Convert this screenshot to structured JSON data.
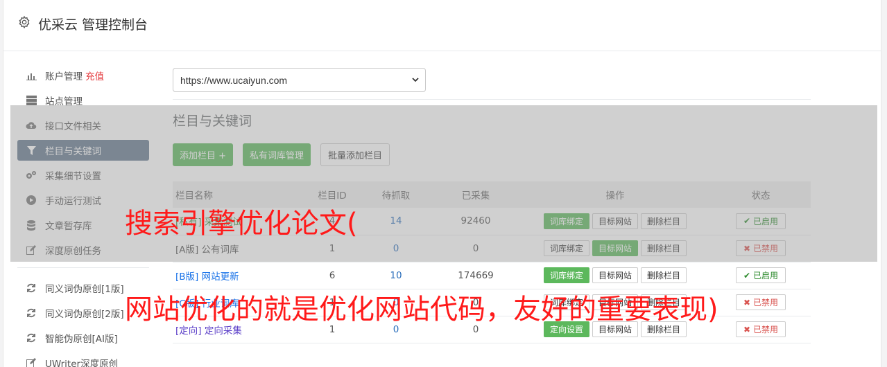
{
  "header": {
    "title": "优采云 管理控制台"
  },
  "sidebar": {
    "items": [
      {
        "label": "账户管理",
        "badge": "充值",
        "icon": "bar-chart-icon"
      },
      {
        "label": "站点管理",
        "icon": "server-icon"
      },
      {
        "label": "接口文件相关",
        "icon": "cloud-upload-icon"
      },
      {
        "label": "栏目与关键词",
        "icon": "filter-icon",
        "active": true
      },
      {
        "label": "采集细节设置",
        "icon": "gears-icon"
      },
      {
        "label": "手动运行测试",
        "icon": "play-circle-icon"
      },
      {
        "label": "文章暂存库",
        "icon": "database-icon"
      },
      {
        "label": "深度原创任务",
        "icon": "edit-icon"
      }
    ],
    "items2": [
      {
        "label": "同义词伪原创[1版]",
        "icon": "refresh-icon"
      },
      {
        "label": "同义词伪原创[2版]",
        "icon": "refresh-icon"
      },
      {
        "label": "智能伪原创[AI版]",
        "icon": "refresh-icon"
      },
      {
        "label": "UWriter深度原创",
        "icon": "edit-icon"
      }
    ]
  },
  "site_select": {
    "value": "https://www.ucaiyun.com"
  },
  "section": {
    "title": "栏目与关键词",
    "buttons": {
      "add": "添加栏目 +",
      "private_lib": "私有词库管理",
      "batch_add": "批量添加栏目"
    }
  },
  "table": {
    "headers": [
      "栏目名称",
      "栏目ID",
      "待抓取",
      "已采集",
      "操作",
      "状态"
    ],
    "rows": [
      {
        "name": "[私有] 采集测试",
        "id": "4",
        "pending": "14",
        "collected": "92460",
        "op1": "词库绑定",
        "op2": "目标网站",
        "op3": "删除栏目",
        "state": "已启用"
      },
      {
        "name": "[A版] 公有词库",
        "id": "1",
        "pending": "0",
        "collected": "0",
        "op1": "词库绑定",
        "op2": "目标网站",
        "op3": "删除栏目",
        "state": "已禁用"
      },
      {
        "name": "[B版] 网站更新",
        "id": "6",
        "pending": "10",
        "collected": "174669",
        "op1": "词库绑定",
        "op2": "目标网站",
        "op3": "删除栏目",
        "state": "已启用"
      },
      {
        "name": "[C版] 行业词库",
        "id": "1",
        "pending": "0",
        "collected": "0",
        "op1": "词库绑定",
        "op2": "目标网站",
        "op3": "删除栏目",
        "state": "已禁用"
      },
      {
        "name": "[定向] 定向采集",
        "id": "1",
        "pending": "0",
        "collected": "0",
        "op1": "定向设置",
        "op2": "目标网站",
        "op3": "删除栏目",
        "state": "已禁用"
      }
    ]
  },
  "watermark": {
    "line1": "搜索引擎优化论文(",
    "line2": "网站优化的就是优化网站代码，友好的重要表现)"
  }
}
